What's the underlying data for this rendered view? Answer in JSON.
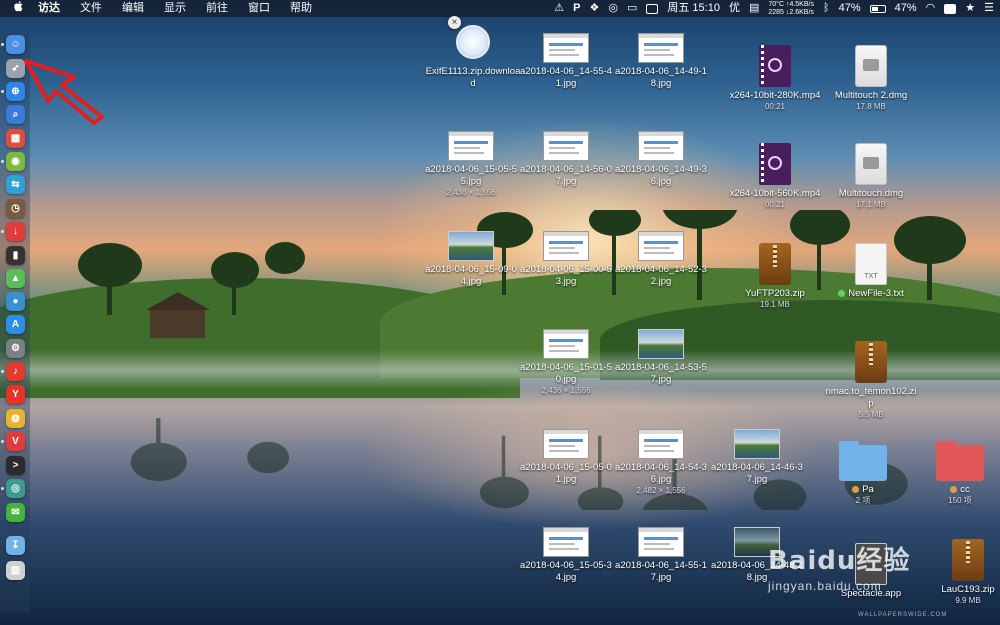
{
  "menubar": {
    "app": "访达",
    "menus": [
      "文件",
      "编辑",
      "显示",
      "前往",
      "窗口",
      "帮助"
    ],
    "clock": "周五 15:10",
    "input_method": "优",
    "netstat": {
      "line1": "70°C ↑4.5KB/s",
      "line2": "2285 ↓2.6KB/s"
    },
    "battery_percent": 47,
    "battery_text_1": "47%",
    "battery_text_2": "47%",
    "status_icons": [
      "warning-icon",
      "paypal-p-icon",
      "wechat-icon",
      "glasses-icon",
      "display-icon",
      "square-icon",
      "text-icon",
      "bluetooth-icon",
      "wifi-icon",
      "scrivener-icon",
      "star-icon",
      "menu-icon"
    ]
  },
  "dock": {
    "icons": [
      {
        "name": "finder-icon",
        "color": "#4a90e2"
      },
      {
        "name": "launchpad-icon",
        "color": "#9aa3ad"
      },
      {
        "name": "safari-icon",
        "color": "#2f86e6"
      },
      {
        "name": "search-app-icon",
        "color": "#3a7bd5"
      },
      {
        "name": "calendar-icon",
        "color": "#e34b3c"
      },
      {
        "name": "android-icon",
        "color": "#7dbb3f"
      },
      {
        "name": "remote-icon",
        "color": "#2e9fd8"
      },
      {
        "name": "clock-icon",
        "color": "#7b5a3c"
      },
      {
        "name": "downie-icon",
        "color": "#e23b3b"
      },
      {
        "name": "activity-monitor-icon",
        "color": "#333333"
      },
      {
        "name": "maps-icon",
        "color": "#5bbc5a"
      },
      {
        "name": "siri-icon",
        "color": "#3a8fd0"
      },
      {
        "name": "app-store-icon",
        "color": "#2d8ee6"
      },
      {
        "name": "system-preferences-icon",
        "color": "#7b7f86"
      },
      {
        "name": "netease-music-icon",
        "color": "#e23a2f"
      },
      {
        "name": "yandex-icon",
        "color": "#e5332a"
      },
      {
        "name": "chrome-icon",
        "color": "#e8b32e"
      },
      {
        "name": "vivaldi-icon",
        "color": "#e23b3b"
      },
      {
        "name": "terminal-icon",
        "color": "#2b2b2b"
      },
      {
        "name": "mirror-icon",
        "color": "#3b9c8f"
      },
      {
        "name": "wechat-dock-icon",
        "color": "#46b33c"
      },
      {
        "name": "downloads-folder-icon",
        "color": "#6fb3e8"
      },
      {
        "name": "trash-icon",
        "color": "#d0d0d0"
      }
    ]
  },
  "desktop": {
    "close_glyph": "×",
    "files": [
      {
        "id": "exif",
        "kind": "safari",
        "name": "ExifE1113.zip.download",
        "meta": ""
      },
      {
        "id": "s1",
        "kind": "shot",
        "name": "a2018-04-06_14-55-41.jpg",
        "meta": ""
      },
      {
        "id": "s2",
        "kind": "shot",
        "name": "a2018-04-06_14-49-18.jpg",
        "meta": ""
      },
      {
        "id": "v1",
        "kind": "video",
        "name": "x264-10bit-280K.mp4",
        "meta": "00:21"
      },
      {
        "id": "d1",
        "kind": "disk",
        "name": "Multitouch 2.dmg",
        "meta": "17.8 MB"
      },
      {
        "id": "s3",
        "kind": "shot",
        "name": "a2018-04-06_15-05-55.jpg",
        "meta": "2,436 × 1,556"
      },
      {
        "id": "s4",
        "kind": "shot",
        "name": "a2018-04-06_14-56-07.jpg",
        "meta": ""
      },
      {
        "id": "s5",
        "kind": "shot",
        "name": "a2018-04-06_14-49-36.jpg",
        "meta": ""
      },
      {
        "id": "v2",
        "kind": "video",
        "name": "x264-10bit-560K.mp4",
        "meta": "00:21"
      },
      {
        "id": "d2",
        "kind": "disk",
        "name": "Multitouch.dmg",
        "meta": "17.1 MB"
      },
      {
        "id": "p1",
        "kind": "photo",
        "name": "a2018-04-06_15-09-04.jpg",
        "meta": ""
      },
      {
        "id": "s6",
        "kind": "shot",
        "name": "a2018-04-06_15-00-53.jpg",
        "meta": ""
      },
      {
        "id": "s7",
        "kind": "shot",
        "name": "a2018-04-06_14-52-32.jpg",
        "meta": ""
      },
      {
        "id": "z1",
        "kind": "zip",
        "name": "YuFTP203.zip",
        "meta": "19.1 MB"
      },
      {
        "id": "t1",
        "kind": "txt",
        "name": "NewFile-3.txt",
        "meta": "",
        "tag_color": "#5ed35e",
        "type_label": "TXT"
      },
      {
        "id": "s8",
        "kind": "shot",
        "name": "a2018-04-06_15-01-50.jpg",
        "meta": "2,436 × 1,556"
      },
      {
        "id": "p2",
        "kind": "photo",
        "name": "a2018-04-06_14-53-57.jpg",
        "meta": ""
      },
      {
        "id": "z2",
        "kind": "zip",
        "name": "nmac.to_temon102.zip",
        "meta": "5.5 MB"
      },
      {
        "id": "s9",
        "kind": "shot",
        "name": "a2018-04-06_15-05-01.jpg",
        "meta": ""
      },
      {
        "id": "s10",
        "kind": "shot",
        "name": "a2018-04-06_14-54-36.jpg",
        "meta": "2,482 × 1,556"
      },
      {
        "id": "p3",
        "kind": "photo",
        "name": "a2018-04-06_14-46-37.jpg",
        "meta": ""
      },
      {
        "id": "f1",
        "kind": "folder-blue",
        "name": "Pa",
        "meta": "2 项",
        "tag_color": "#e0a23a"
      },
      {
        "id": "f2",
        "kind": "folder-red",
        "name": "cc",
        "meta": "150 项",
        "tag_color": "#e0a23a"
      },
      {
        "id": "s11",
        "kind": "shot",
        "name": "a2018-04-06_15-05-34.jpg",
        "meta": ""
      },
      {
        "id": "s12",
        "kind": "shot",
        "name": "a2018-04-06_14-55-17.jpg",
        "meta": ""
      },
      {
        "id": "p4",
        "kind": "photo",
        "name": "a2018-04-06_14-48-28.jpg",
        "meta": ""
      },
      {
        "id": "app1",
        "kind": "app",
        "name": "Spectacle.app",
        "meta": ""
      },
      {
        "id": "z3",
        "kind": "zip",
        "name": "LauC193.zip",
        "meta": "9.9 MB"
      }
    ]
  },
  "watermark": {
    "brand": "Baidu经验",
    "url": "jingyan.baidu.com",
    "site": "WALLPAPERSWIDE.COM"
  },
  "annotation": {
    "arrow_color": "#e02020"
  }
}
